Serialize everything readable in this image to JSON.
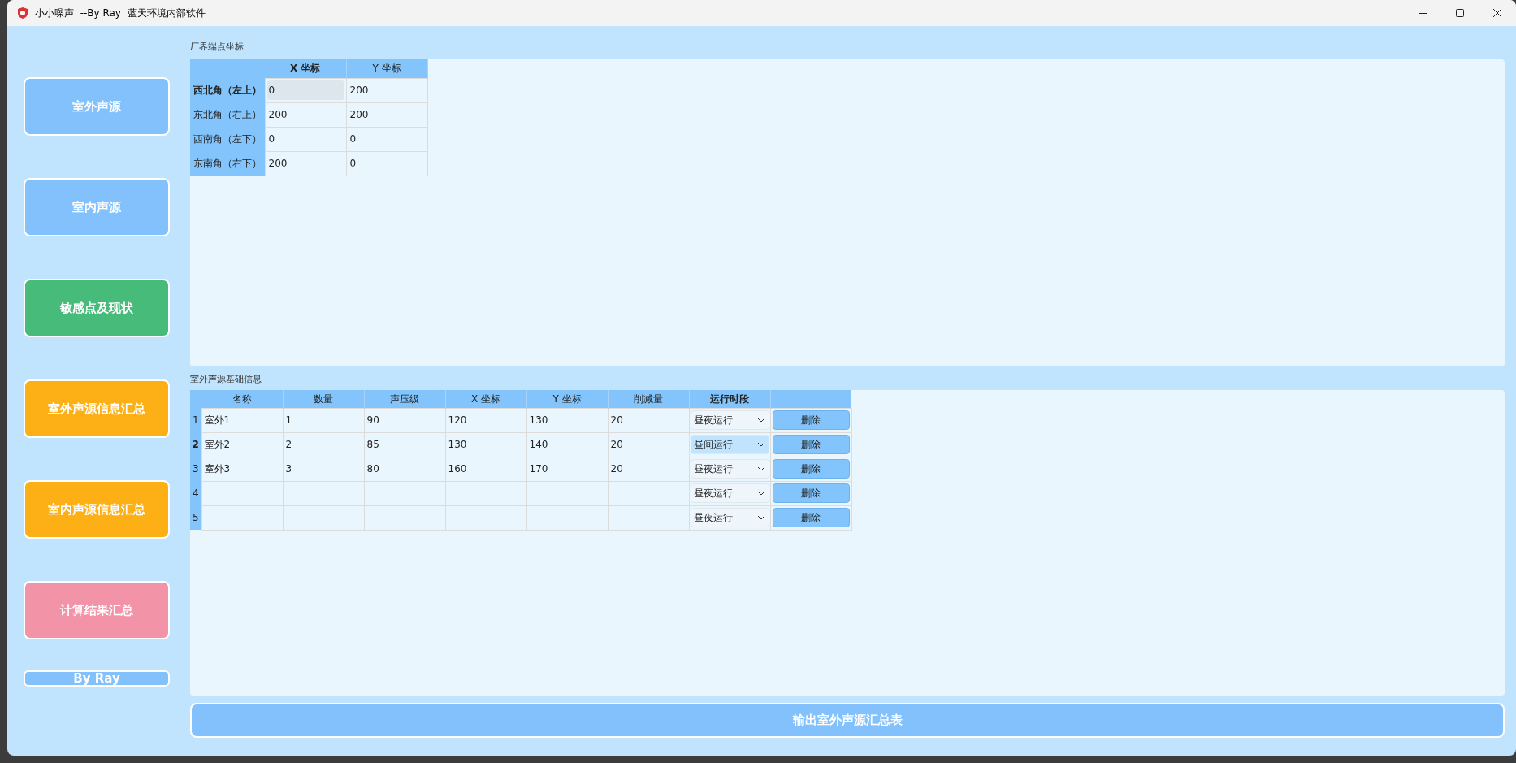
{
  "window": {
    "title": "小小噪声  --By Ray  蓝天环境内部软件"
  },
  "sidebar": {
    "items": [
      {
        "label": "室外声源",
        "color": "#82c1fc"
      },
      {
        "label": "室内声源",
        "color": "#82c1fc"
      },
      {
        "label": "敏感点及现状",
        "color": "#46bb7a"
      },
      {
        "label": "室外声源信息汇总",
        "color": "#fdb016"
      },
      {
        "label": "室内声源信息汇总",
        "color": "#fdb016"
      },
      {
        "label": "计算结果汇总",
        "color": "#f393a8"
      }
    ],
    "footer": "By Ray"
  },
  "boundary": {
    "title": "厂界端点坐标",
    "columns": [
      {
        "label": "X 坐标",
        "selected": true
      },
      {
        "label": "Y 坐标",
        "selected": false
      }
    ],
    "rows": [
      {
        "header": "西北角（左上）",
        "selected": true,
        "cells": [
          {
            "text": "0",
            "current": true
          },
          {
            "text": "200",
            "current": false
          }
        ]
      },
      {
        "header": "东北角（右上）",
        "selected": false,
        "cells": [
          {
            "text": "200",
            "current": false
          },
          {
            "text": "200",
            "current": false
          }
        ]
      },
      {
        "header": "西南角（左下）",
        "selected": false,
        "cells": [
          {
            "text": "0",
            "current": false
          },
          {
            "text": "0",
            "current": false
          }
        ]
      },
      {
        "header": "东南角（右下）",
        "selected": false,
        "cells": [
          {
            "text": "200",
            "current": false
          },
          {
            "text": "0",
            "current": false
          }
        ]
      }
    ]
  },
  "sources": {
    "title": "室外声源基础信息",
    "columns": [
      {
        "label": "名称",
        "selected": false
      },
      {
        "label": "数量",
        "selected": false
      },
      {
        "label": "声压级",
        "selected": false
      },
      {
        "label": "X 坐标",
        "selected": false
      },
      {
        "label": "Y 坐标",
        "selected": false
      },
      {
        "label": "削减量",
        "selected": false
      },
      {
        "label": "运行时段",
        "selected": true
      }
    ],
    "rows": [
      {
        "number": "1",
        "selected": false,
        "cells": [
          "室外1",
          "1",
          "90",
          "120",
          "130",
          "20"
        ],
        "period": "昼夜运行",
        "period_focused": false,
        "delete": "删除"
      },
      {
        "number": "2",
        "selected": true,
        "cells": [
          "室外2",
          "2",
          "85",
          "130",
          "140",
          "20"
        ],
        "period": "昼间运行",
        "period_focused": true,
        "delete": "删除"
      },
      {
        "number": "3",
        "selected": false,
        "cells": [
          "室外3",
          "3",
          "80",
          "160",
          "170",
          "20"
        ],
        "period": "昼夜运行",
        "period_focused": false,
        "delete": "删除"
      },
      {
        "number": "4",
        "selected": false,
        "cells": [
          "",
          "",
          "",
          "",
          "",
          ""
        ],
        "period": "昼夜运行",
        "period_focused": false,
        "delete": "删除"
      },
      {
        "number": "5",
        "selected": false,
        "cells": [
          "",
          "",
          "",
          "",
          "",
          ""
        ],
        "period": "昼夜运行",
        "period_focused": false,
        "delete": "删除"
      }
    ]
  },
  "export_button": "输出室外声源汇总表"
}
